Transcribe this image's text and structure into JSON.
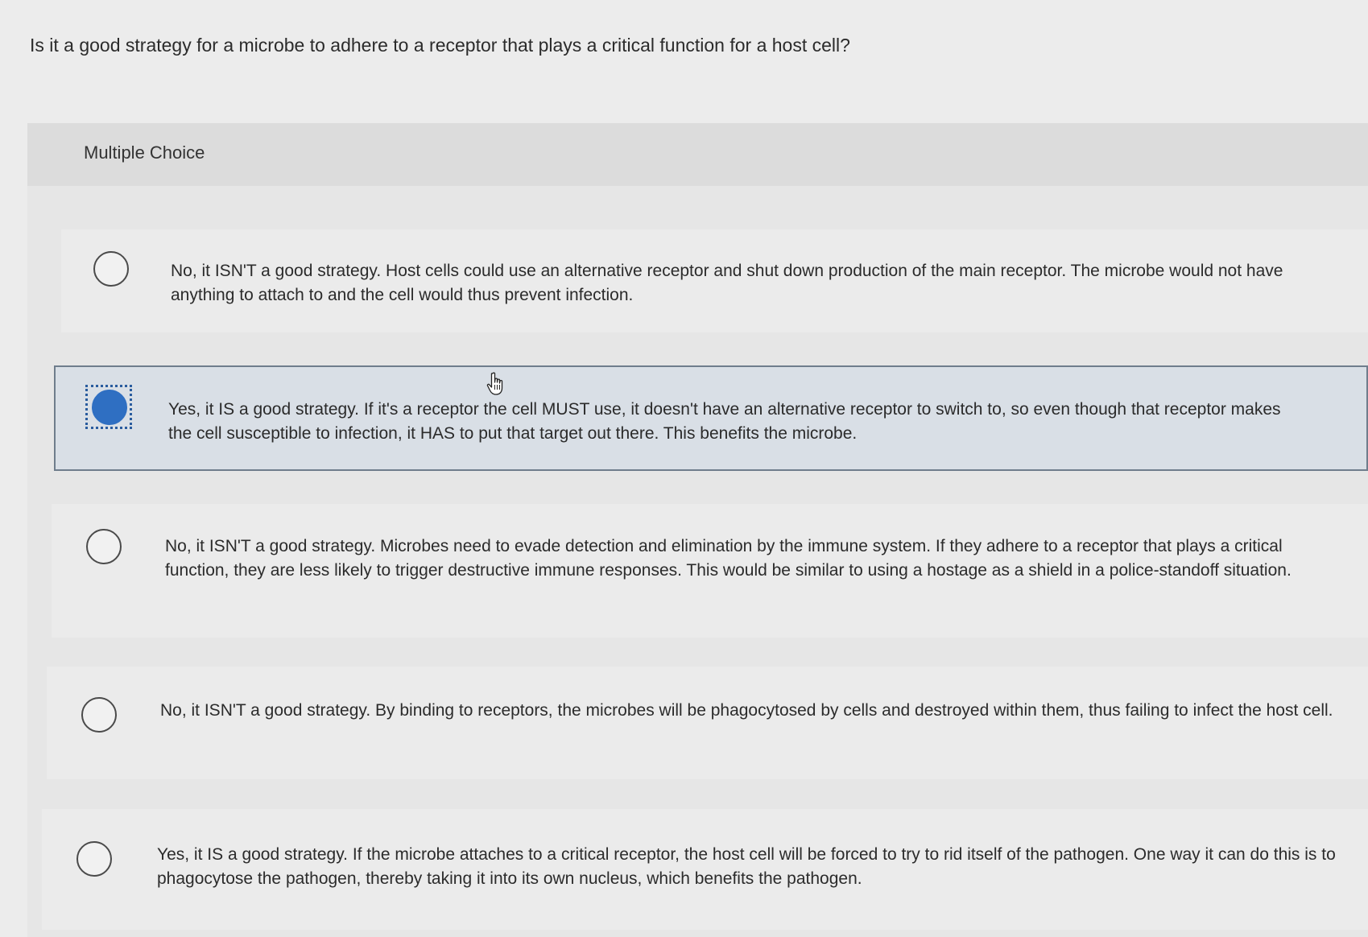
{
  "question": {
    "text": "Is it a good strategy for a microbe to adhere to a receptor that plays a critical function for a host cell?"
  },
  "quiz": {
    "type_label": "Multiple Choice",
    "selected_index": 1,
    "options": [
      {
        "text": "No, it ISN'T a good strategy. Host cells could use an alternative receptor and shut down production of the main receptor. The microbe would not have anything to attach to and the cell would thus prevent infection.",
        "selected": false
      },
      {
        "text": "Yes, it IS a good strategy. If it's a receptor the cell MUST use, it doesn't have an alternative receptor to switch to, so even though that receptor makes the cell susceptible to infection, it HAS to put that target out there. This benefits the microbe.",
        "selected": true
      },
      {
        "text": "No, it ISN'T a good strategy. Microbes need to evade detection and elimination by the immune system. If they adhere to a receptor that plays a critical function, they are less likely to trigger destructive immune responses. This would be similar to using a hostage as a shield in a police-standoff situation.",
        "selected": false
      },
      {
        "text": "No, it ISN'T a good strategy. By binding to receptors, the microbes will be phagocytosed by cells and destroyed within them, thus failing to infect the host cell.",
        "selected": false
      },
      {
        "text": "Yes, it IS a good strategy. If the microbe attaches to a critical receptor, the host cell will be forced to try to rid itself of the pathogen. One way it can do this is to phagocytose the pathogen, thereby taking it into its own nucleus, which benefits the pathogen.",
        "selected": false
      }
    ]
  },
  "colors": {
    "selected_fill": "#2f6fc2",
    "selected_background": "#d9dfe6"
  },
  "icons": {
    "cursor": "hand-pointer-icon",
    "radio_checked": "radio-checked-icon",
    "radio_unchecked": "radio-unchecked-icon"
  }
}
